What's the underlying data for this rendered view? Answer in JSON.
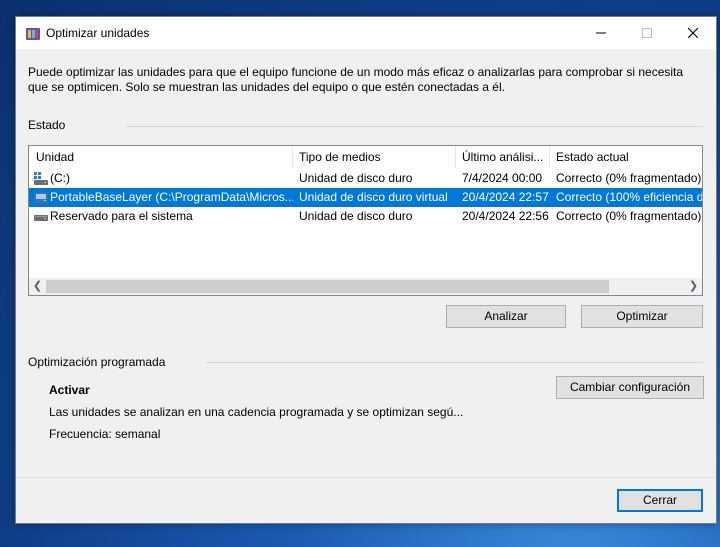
{
  "window": {
    "title": "Optimizar unidades",
    "icon": "defrag-app-icon",
    "controls": {
      "minimize": "minimize-icon",
      "maximize": "maximize-icon",
      "close": "close-icon"
    }
  },
  "intro": "Puede optimizar las unidades para que el equipo funcione de un modo más eficaz o analizarlas para comprobar si necesita que se optimicen. Solo se muestran las unidades del equipo o que estén conectadas a él.",
  "status": {
    "group_label": "Estado",
    "columns": [
      "Unidad",
      "Tipo de medios",
      "Último análisi...",
      "Estado actual"
    ],
    "rows": [
      {
        "drive": "(C:)",
        "media": "Unidad de disco duro",
        "last": "7/4/2024 00:00",
        "state": "Correcto (0% fragmentado)",
        "icon": "windows-drive-icon",
        "selected": false
      },
      {
        "drive": "PortableBaseLayer (C:\\ProgramData\\Micros...",
        "media": "Unidad de disco duro virtual",
        "last": "20/4/2024 22:57",
        "state": "Correcto (100% eficiencia d",
        "icon": "virtual-drive-icon",
        "selected": true
      },
      {
        "drive": "Reservado para el sistema",
        "media": "Unidad de disco duro",
        "last": "20/4/2024 22:56",
        "state": "Correcto (0% fragmentado)",
        "icon": "hard-drive-icon",
        "selected": false
      }
    ],
    "analyze_button": "Analizar",
    "optimize_button": "Optimizar"
  },
  "scheduled": {
    "group_label": "Optimización programada",
    "state": "Activar",
    "description": "Las unidades se analizan en una cadencia programada y se optimizan segú...",
    "frequency": "Frecuencia: semanal",
    "change_button": "Cambiar configuración"
  },
  "close_button": "Cerrar"
}
